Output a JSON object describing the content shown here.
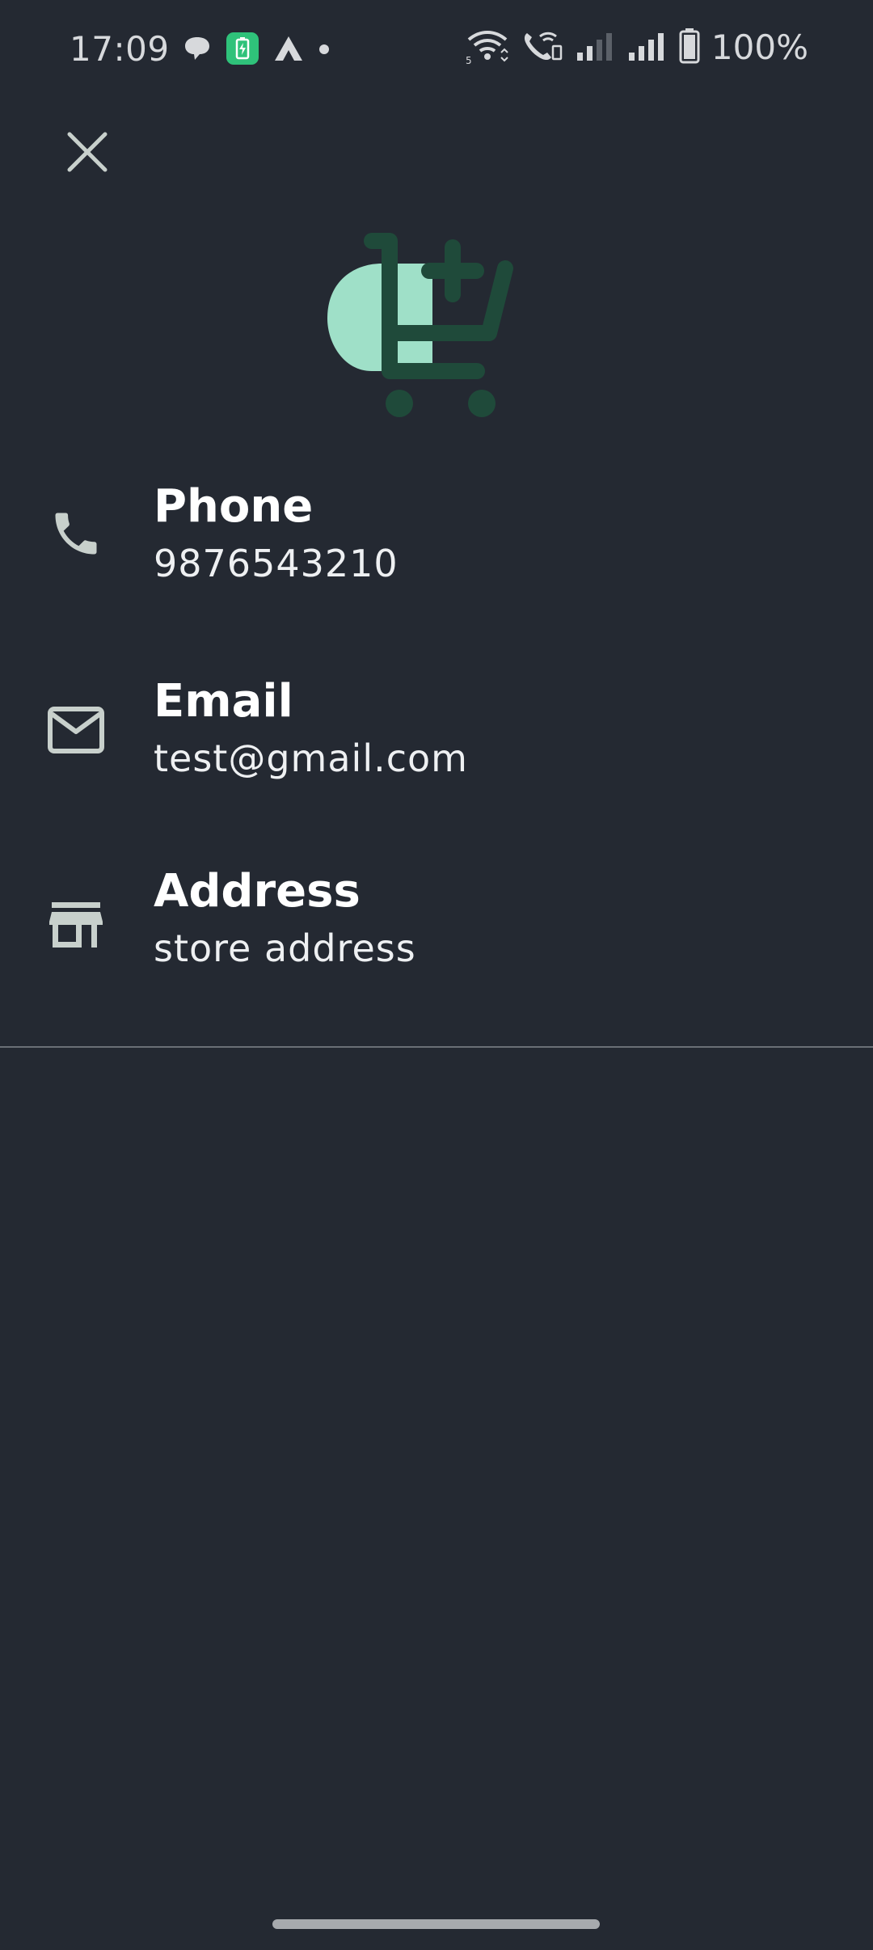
{
  "status_bar": {
    "time": "17:09",
    "battery": "100%",
    "left_icons": [
      "chat-bubble-icon",
      "battery-saver-app-icon",
      "triangle-app-icon",
      "dot-icon"
    ],
    "right_icons": [
      "wifi-icon",
      "wifi-call-icon",
      "signal-weak-icon",
      "signal-full-icon",
      "battery-icon"
    ]
  },
  "header": {
    "close_icon": "close-icon"
  },
  "logo": {
    "icon": "cart-add-logo-icon",
    "colors": {
      "circle": "#9fe0c8",
      "cart": "#1f4a3a"
    }
  },
  "contacts": [
    {
      "title": "Phone",
      "value": "9876543210",
      "icon": "phone-icon"
    },
    {
      "title": "Email",
      "value": "test@gmail.com",
      "icon": "mail-icon"
    },
    {
      "title": "Address",
      "value": "store address",
      "icon": "store-icon"
    }
  ],
  "colors": {
    "background": "#242932",
    "icon": "#c8d0cc",
    "text": "#ffffff"
  }
}
